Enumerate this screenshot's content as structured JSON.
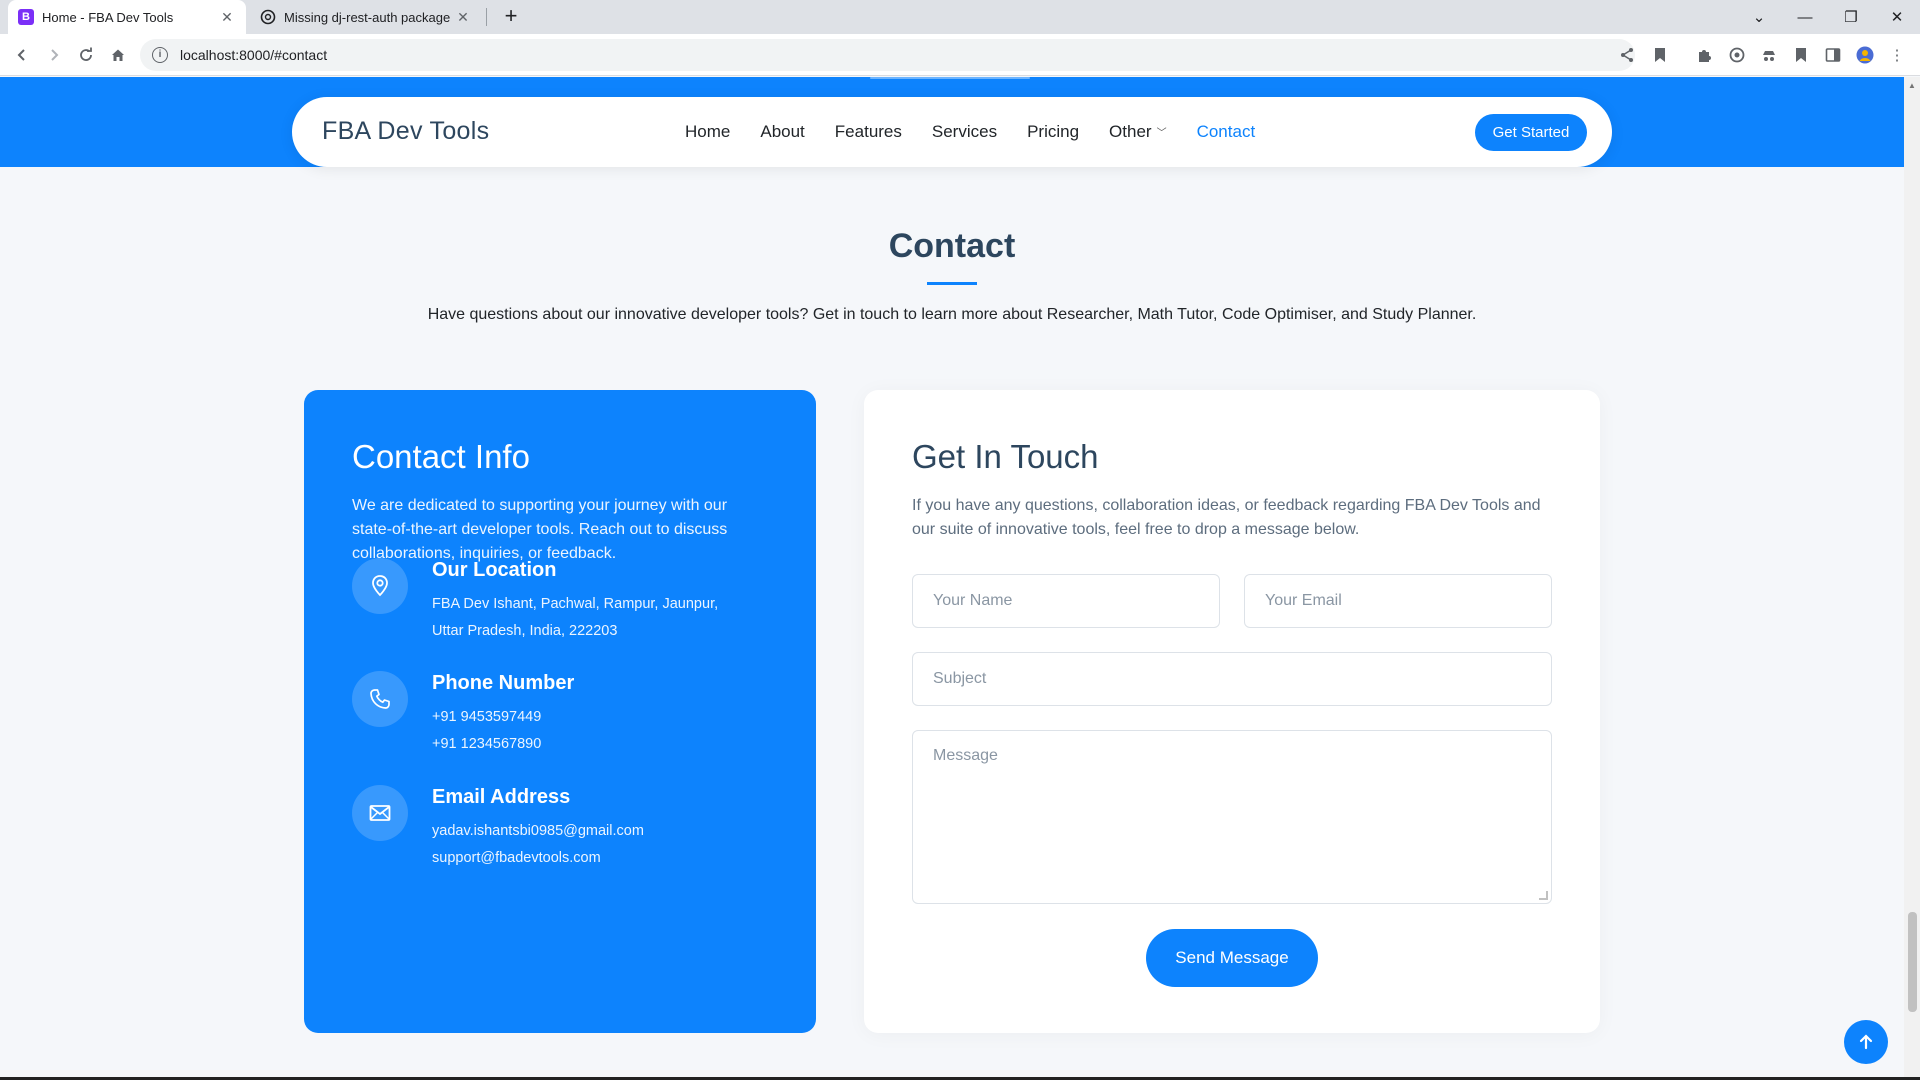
{
  "browser": {
    "tabs": [
      {
        "title": "Home - FBA Dev Tools",
        "favicon": "B",
        "favicon_color": "#7b2ff7",
        "active": true
      },
      {
        "title": "Missing dj-rest-auth package",
        "favicon": "openai-icon",
        "active": false
      }
    ],
    "url": "localhost:8000/#contact"
  },
  "navbar": {
    "brand": "FBA Dev Tools",
    "items": [
      {
        "label": "Home"
      },
      {
        "label": "About"
      },
      {
        "label": "Features"
      },
      {
        "label": "Services"
      },
      {
        "label": "Pricing"
      },
      {
        "label": "Other"
      },
      {
        "label": "Contact"
      }
    ],
    "cta": "Get Started"
  },
  "section": {
    "title": "Contact",
    "subtitle": "Have questions about our innovative developer tools? Get in touch to learn more about Researcher, Math Tutor, Code Optimiser, and Study Planner."
  },
  "contact_info": {
    "title": "Contact Info",
    "intro": "We are dedicated to supporting your journey with our state-of-the-art developer tools. Reach out to discuss collaborations, inquiries, or feedback.",
    "location": {
      "label": "Our Location",
      "lines": [
        "FBA Dev Ishant, Pachwal, Rampur, Jaunpur,",
        "Uttar Pradesh, India, 222203"
      ]
    },
    "phone": {
      "label": "Phone Number",
      "lines": [
        "+91 9453597449",
        "+91 1234567890"
      ]
    },
    "email": {
      "label": "Email Address",
      "lines": [
        "yadav.ishantsbi0985@gmail.com",
        "support@fbadevtools.com"
      ]
    }
  },
  "form": {
    "title": "Get In Touch",
    "intro": "If you have any questions, collaboration ideas, or feedback regarding FBA Dev Tools and our suite of innovative tools, feel free to drop a message below.",
    "name_placeholder": "Your Name",
    "email_placeholder": "Your Email",
    "subject_placeholder": "Subject",
    "message_placeholder": "Message",
    "submit": "Send Message"
  },
  "colors": {
    "accent": "#0d83fd",
    "heading": "#2d465e"
  }
}
